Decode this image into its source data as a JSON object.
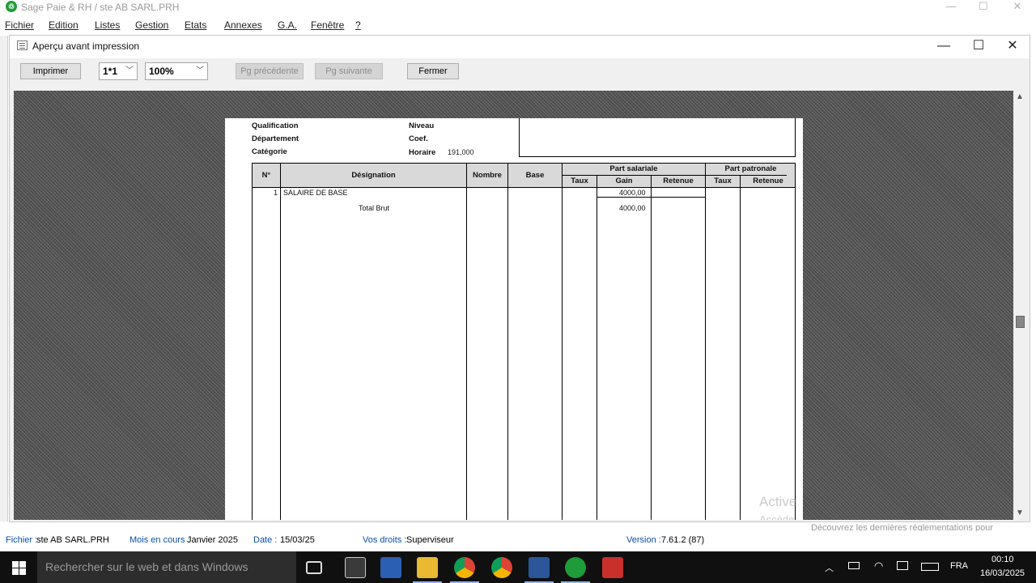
{
  "app": {
    "title": "Sage Paie & RH / ste AB SARL.PRH",
    "logo_glyph": "♲",
    "controls": [
      "—",
      "☐",
      "✕"
    ]
  },
  "menu": [
    "Fichier",
    "Edition",
    "Listes",
    "Gestion",
    "Etats",
    "Annexes",
    "G.A.",
    "Fenêtre",
    "?"
  ],
  "preview": {
    "title": "Aperçu avant impression",
    "controls": [
      "—",
      "☐",
      "✕"
    ],
    "toolbar": {
      "print": "Imprimer",
      "pages_select": "1*1",
      "zoom_select": "100%",
      "prev_page": "Pg précédente",
      "next_page": "Pg suivante",
      "close": "Fermer"
    }
  },
  "payslip": {
    "fields": {
      "qualification_label": "Qualification",
      "niveau_label": "Niveau",
      "departement_label": "Département",
      "coef_label": "Coef.",
      "categorie_label": "Catégorie",
      "horaire_label": "Horaire",
      "horaire_value": "191,000"
    },
    "headers": {
      "num": "N°",
      "designation": "Désignation",
      "nombre": "Nombre",
      "base": "Base",
      "part_salariale": "Part salariale",
      "taux_sal": "Taux",
      "gain": "Gain",
      "retenue_sal": "Retenue",
      "part_patronale": "Part patronale",
      "taux_pat": "Taux",
      "retenue_pat": "Retenue"
    },
    "rows": [
      {
        "num": "1",
        "designation": "SALAIRE DE BASE",
        "gain": "4000,00"
      },
      {
        "num": "",
        "designation": "Total Brut",
        "gain": "4000,00"
      }
    ]
  },
  "status": {
    "fichier_label": "Fichier :",
    "fichier_value": "ste AB SARL.PRH",
    "mois_label": "Mois en cours :",
    "mois_value": "Janvier 2025",
    "date_label": "Date :",
    "date_value": "15/03/25",
    "droits_label": "Vos droits :",
    "droits_value": "Superviseur",
    "version_label": "Version :",
    "version_value": "7.61.2 (87)"
  },
  "watermark": {
    "line1": "Active",
    "line2": "Accéde",
    "line3": "Découvrez les dernières réglementations pour"
  },
  "taskbar": {
    "search_placeholder": "Rechercher sur le web et dans Windows",
    "lang": "FRA",
    "time": "00:10",
    "date": "16/03/2025"
  }
}
